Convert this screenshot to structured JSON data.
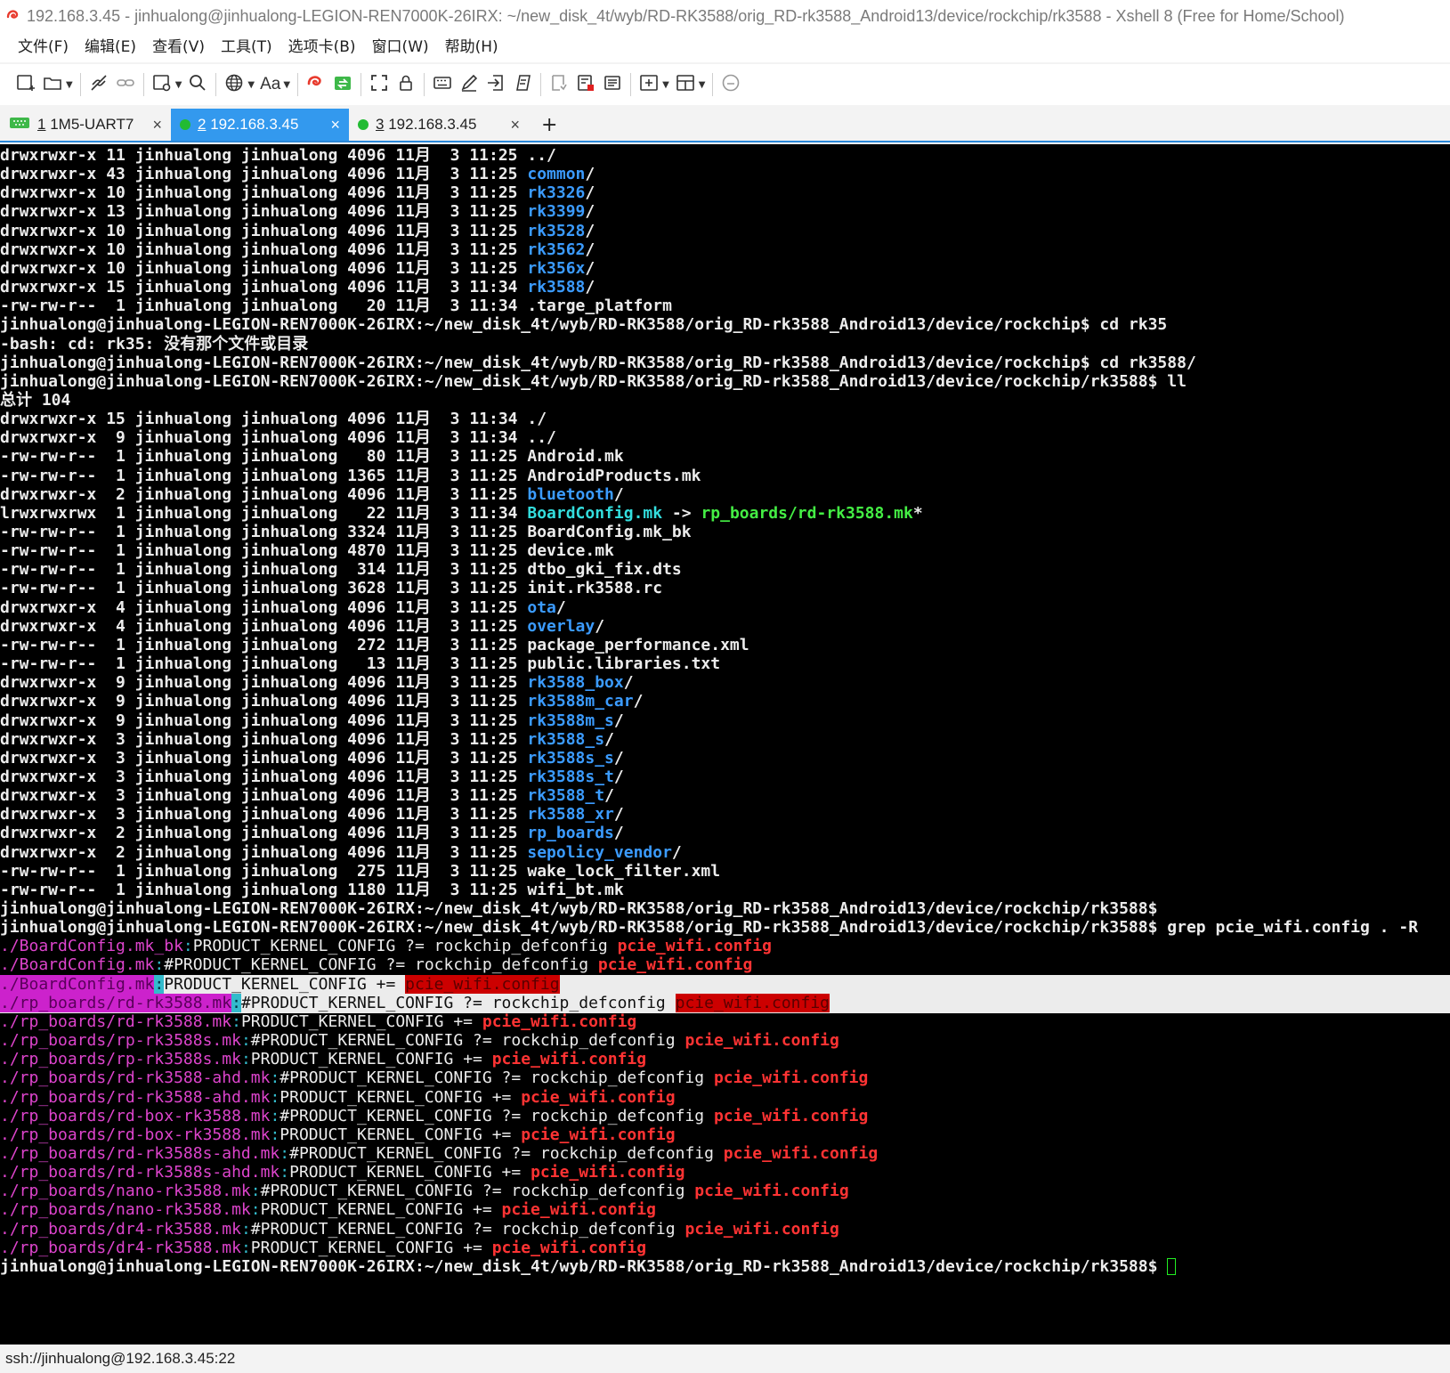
{
  "window": {
    "title": "192.168.3.45 - jinhualong@jinhualong-LEGION-REN7000K-26IRX: ~/new_disk_4t/wyb/RD-RK3588/orig_RD-rk3588_Android13/device/rockchip/rk3588 - Xshell 8 (Free for Home/School)"
  },
  "menu": [
    "文件(F)",
    "编辑(E)",
    "查看(V)",
    "工具(T)",
    "选项卡(B)",
    "窗口(W)",
    "帮助(H)"
  ],
  "toolbar": {
    "font_label": "Aa"
  },
  "tabs": [
    {
      "num": "1",
      "label": "1M5-UART7",
      "close": "×",
      "status": "serial"
    },
    {
      "num": "2",
      "label": "192.168.3.45",
      "close": "×",
      "status": "connected",
      "active": true
    },
    {
      "num": "3",
      "label": "192.168.3.45",
      "close": "×",
      "status": "connected"
    }
  ],
  "tab_add": "+",
  "colors": {
    "tab_active": "#3399ee",
    "connected": "#22bb33",
    "dir": "#3b9bff",
    "match": "#ff3333",
    "filename": "#dd44cc",
    "exe": "#44ee44"
  },
  "terminal": {
    "lines": [
      [
        {
          "t": "drwxrwxr-x 11 jinhualong jinhualong 4096 11月  3 11:25 ",
          "c": "b"
        },
        {
          "t": "../",
          "c": "b"
        }
      ],
      [
        {
          "t": "drwxrwxr-x 43 jinhualong jinhualong 4096 11月  3 11:25 ",
          "c": "b"
        },
        {
          "t": "common",
          "c": "dir"
        },
        {
          "t": "/",
          "c": "b"
        }
      ],
      [
        {
          "t": "drwxrwxr-x 10 jinhualong jinhualong 4096 11月  3 11:25 ",
          "c": "b"
        },
        {
          "t": "rk3326",
          "c": "dir"
        },
        {
          "t": "/",
          "c": "b"
        }
      ],
      [
        {
          "t": "drwxrwxr-x 13 jinhualong jinhualong 4096 11月  3 11:25 ",
          "c": "b"
        },
        {
          "t": "rk3399",
          "c": "dir"
        },
        {
          "t": "/",
          "c": "b"
        }
      ],
      [
        {
          "t": "drwxrwxr-x 10 jinhualong jinhualong 4096 11月  3 11:25 ",
          "c": "b"
        },
        {
          "t": "rk3528",
          "c": "dir"
        },
        {
          "t": "/",
          "c": "b"
        }
      ],
      [
        {
          "t": "drwxrwxr-x 10 jinhualong jinhualong 4096 11月  3 11:25 ",
          "c": "b"
        },
        {
          "t": "rk3562",
          "c": "dir"
        },
        {
          "t": "/",
          "c": "b"
        }
      ],
      [
        {
          "t": "drwxrwxr-x 10 jinhualong jinhualong 4096 11月  3 11:25 ",
          "c": "b"
        },
        {
          "t": "rk356x",
          "c": "dir"
        },
        {
          "t": "/",
          "c": "b"
        }
      ],
      [
        {
          "t": "drwxrwxr-x 15 jinhualong jinhualong 4096 11月  3 11:34 ",
          "c": "b"
        },
        {
          "t": "rk3588",
          "c": "dir"
        },
        {
          "t": "/",
          "c": "b"
        }
      ],
      [
        {
          "t": "-rw-rw-r--  1 jinhualong jinhualong   20 11月  3 11:34 .targe_platform",
          "c": "b"
        }
      ],
      [
        {
          "t": "jinhualong@jinhualong-LEGION-REN7000K-26IRX:~/new_disk_4t/wyb/RD-RK3588/orig_RD-rk3588_Android13/device/rockchip$ cd rk35",
          "c": "b"
        }
      ],
      [
        {
          "t": "-bash: cd: rk35: 没有那个文件或目录",
          "c": "b"
        }
      ],
      [
        {
          "t": "jinhualong@jinhualong-LEGION-REN7000K-26IRX:~/new_disk_4t/wyb/RD-RK3588/orig_RD-rk3588_Android13/device/rockchip$ cd rk3588/",
          "c": "b"
        }
      ],
      [
        {
          "t": "jinhualong@jinhualong-LEGION-REN7000K-26IRX:~/new_disk_4t/wyb/RD-RK3588/orig_RD-rk3588_Android13/device/rockchip/rk3588$ ll",
          "c": "b"
        }
      ],
      [
        {
          "t": "总计 104",
          "c": "b"
        }
      ],
      [
        {
          "t": "drwxrwxr-x 15 jinhualong jinhualong 4096 11月  3 11:34 ./",
          "c": "b"
        }
      ],
      [
        {
          "t": "drwxrwxr-x  9 jinhualong jinhualong 4096 11月  3 11:34 ../",
          "c": "b"
        }
      ],
      [
        {
          "t": "-rw-rw-r--  1 jinhualong jinhualong   80 11月  3 11:25 Android.mk",
          "c": "b"
        }
      ],
      [
        {
          "t": "-rw-rw-r--  1 jinhualong jinhualong 1365 11月  3 11:25 AndroidProducts.mk",
          "c": "b"
        }
      ],
      [
        {
          "t": "drwxrwxr-x  2 jinhualong jinhualong 4096 11月  3 11:25 ",
          "c": "b"
        },
        {
          "t": "bluetooth",
          "c": "dir"
        },
        {
          "t": "/",
          "c": "b"
        }
      ],
      [
        {
          "t": "lrwxrwxrwx  1 jinhualong jinhualong   22 11月  3 11:34 ",
          "c": "b"
        },
        {
          "t": "BoardConfig.mk",
          "c": "link"
        },
        {
          "t": " -> ",
          "c": "b"
        },
        {
          "t": "rp_boards/rd-rk3588.mk",
          "c": "exe"
        },
        {
          "t": "*",
          "c": "b"
        }
      ],
      [
        {
          "t": "-rw-rw-r--  1 jinhualong jinhualong 3324 11月  3 11:25 BoardConfig.mk_bk",
          "c": "b"
        }
      ],
      [
        {
          "t": "-rw-rw-r--  1 jinhualong jinhualong 4870 11月  3 11:25 device.mk",
          "c": "b"
        }
      ],
      [
        {
          "t": "-rw-rw-r--  1 jinhualong jinhualong  314 11月  3 11:25 dtbo_gki_fix.dts",
          "c": "b"
        }
      ],
      [
        {
          "t": "-rw-rw-r--  1 jinhualong jinhualong 3628 11月  3 11:25 init.rk3588.rc",
          "c": "b"
        }
      ],
      [
        {
          "t": "drwxrwxr-x  4 jinhualong jinhualong 4096 11月  3 11:25 ",
          "c": "b"
        },
        {
          "t": "ota",
          "c": "dir"
        },
        {
          "t": "/",
          "c": "b"
        }
      ],
      [
        {
          "t": "drwxrwxr-x  4 jinhualong jinhualong 4096 11月  3 11:25 ",
          "c": "b"
        },
        {
          "t": "overlay",
          "c": "dir"
        },
        {
          "t": "/",
          "c": "b"
        }
      ],
      [
        {
          "t": "-rw-rw-r--  1 jinhualong jinhualong  272 11月  3 11:25 package_performance.xml",
          "c": "b"
        }
      ],
      [
        {
          "t": "-rw-rw-r--  1 jinhualong jinhualong   13 11月  3 11:25 public.libraries.txt",
          "c": "b"
        }
      ],
      [
        {
          "t": "drwxrwxr-x  9 jinhualong jinhualong 4096 11月  3 11:25 ",
          "c": "b"
        },
        {
          "t": "rk3588_box",
          "c": "dir"
        },
        {
          "t": "/",
          "c": "b"
        }
      ],
      [
        {
          "t": "drwxrwxr-x  9 jinhualong jinhualong 4096 11月  3 11:25 ",
          "c": "b"
        },
        {
          "t": "rk3588m_car",
          "c": "dir"
        },
        {
          "t": "/",
          "c": "b"
        }
      ],
      [
        {
          "t": "drwxrwxr-x  9 jinhualong jinhualong 4096 11月  3 11:25 ",
          "c": "b"
        },
        {
          "t": "rk3588m_s",
          "c": "dir"
        },
        {
          "t": "/",
          "c": "b"
        }
      ],
      [
        {
          "t": "drwxrwxr-x  3 jinhualong jinhualong 4096 11月  3 11:25 ",
          "c": "b"
        },
        {
          "t": "rk3588_s",
          "c": "dir"
        },
        {
          "t": "/",
          "c": "b"
        }
      ],
      [
        {
          "t": "drwxrwxr-x  3 jinhualong jinhualong 4096 11月  3 11:25 ",
          "c": "b"
        },
        {
          "t": "rk3588s_s",
          "c": "dir"
        },
        {
          "t": "/",
          "c": "b"
        }
      ],
      [
        {
          "t": "drwxrwxr-x  3 jinhualong jinhualong 4096 11月  3 11:25 ",
          "c": "b"
        },
        {
          "t": "rk3588s_t",
          "c": "dir"
        },
        {
          "t": "/",
          "c": "b"
        }
      ],
      [
        {
          "t": "drwxrwxr-x  3 jinhualong jinhualong 4096 11月  3 11:25 ",
          "c": "b"
        },
        {
          "t": "rk3588_t",
          "c": "dir"
        },
        {
          "t": "/",
          "c": "b"
        }
      ],
      [
        {
          "t": "drwxrwxr-x  3 jinhualong jinhualong 4096 11月  3 11:25 ",
          "c": "b"
        },
        {
          "t": "rk3588_xr",
          "c": "dir"
        },
        {
          "t": "/",
          "c": "b"
        }
      ],
      [
        {
          "t": "drwxrwxr-x  2 jinhualong jinhualong 4096 11月  3 11:25 ",
          "c": "b"
        },
        {
          "t": "rp_boards",
          "c": "dir"
        },
        {
          "t": "/",
          "c": "b"
        }
      ],
      [
        {
          "t": "drwxrwxr-x  2 jinhualong jinhualong 4096 11月  3 11:25 ",
          "c": "b"
        },
        {
          "t": "sepolicy_vendor",
          "c": "dir"
        },
        {
          "t": "/",
          "c": "b"
        }
      ],
      [
        {
          "t": "-rw-rw-r--  1 jinhualong jinhualong  275 11月  3 11:25 wake_lock_filter.xml",
          "c": "b"
        }
      ],
      [
        {
          "t": "-rw-rw-r--  1 jinhualong jinhualong 1180 11月  3 11:25 wifi_bt.mk",
          "c": "b"
        }
      ],
      [
        {
          "t": "jinhualong@jinhualong-LEGION-REN7000K-26IRX:~/new_disk_4t/wyb/RD-RK3588/orig_RD-rk3588_Android13/device/rockchip/rk3588$",
          "c": "b"
        }
      ],
      [
        {
          "t": "jinhualong@jinhualong-LEGION-REN7000K-26IRX:~/new_disk_4t/wyb/RD-RK3588/orig_RD-rk3588_Android13/device/rockchip/rk3588$ grep pcie_wifi.config . -R",
          "c": "b"
        }
      ],
      [
        {
          "t": "./BoardConfig.mk_bk",
          "c": "fn"
        },
        {
          "t": ":",
          "c": "sep"
        },
        {
          "t": "PRODUCT_KERNEL_CONFIG ?= rockchip_defconfig ",
          "c": "plain"
        },
        {
          "t": "pcie_wifi.config",
          "c": "match"
        }
      ],
      [
        {
          "t": "./BoardConfig.mk",
          "c": "fn"
        },
        {
          "t": ":",
          "c": "sep"
        },
        {
          "t": "#PRODUCT_KERNEL_CONFIG ?= rockchip_defconfig ",
          "c": "plain"
        },
        {
          "t": "pcie_wifi.config",
          "c": "match"
        }
      ],
      [
        {
          "t": "./BoardConfig.mk",
          "c": "fn"
        },
        {
          "t": ":",
          "c": "sep"
        },
        {
          "t": "PRODUCT_KERNEL_CONFIG += ",
          "c": "plain"
        },
        {
          "t": "pcie_wifi.config",
          "c": "match"
        }
      ],
      [
        {
          "t": "./rp_boards/rd-rk3588.mk",
          "c": "fn"
        },
        {
          "t": ":",
          "c": "sep"
        },
        {
          "t": "#PRODUCT_KERNEL_CONFIG ?= rockchip_defconfig ",
          "c": "plain"
        },
        {
          "t": "pcie_wifi.config",
          "c": "match"
        }
      ],
      [
        {
          "t": "./rp_boards/rd-rk3588.mk",
          "c": "fn"
        },
        {
          "t": ":",
          "c": "sep"
        },
        {
          "t": "PRODUCT_KERNEL_CONFIG += ",
          "c": "plain"
        },
        {
          "t": "pcie_wifi.config",
          "c": "match"
        }
      ],
      [
        {
          "t": "./rp_boards/rp-rk3588s.mk",
          "c": "fn"
        },
        {
          "t": ":",
          "c": "sep"
        },
        {
          "t": "#PRODUCT_KERNEL_CONFIG ?= rockchip_defconfig ",
          "c": "plain"
        },
        {
          "t": "pcie_wifi.config",
          "c": "match"
        }
      ],
      [
        {
          "t": "./rp_boards/rp-rk3588s.mk",
          "c": "fn"
        },
        {
          "t": ":",
          "c": "sep"
        },
        {
          "t": "PRODUCT_KERNEL_CONFIG += ",
          "c": "plain"
        },
        {
          "t": "pcie_wifi.config",
          "c": "match"
        }
      ],
      [
        {
          "t": "./rp_boards/rd-rk3588-ahd.mk",
          "c": "fn"
        },
        {
          "t": ":",
          "c": "sep"
        },
        {
          "t": "#PRODUCT_KERNEL_CONFIG ?= rockchip_defconfig ",
          "c": "plain"
        },
        {
          "t": "pcie_wifi.config",
          "c": "match"
        }
      ],
      [
        {
          "t": "./rp_boards/rd-rk3588-ahd.mk",
          "c": "fn"
        },
        {
          "t": ":",
          "c": "sep"
        },
        {
          "t": "PRODUCT_KERNEL_CONFIG += ",
          "c": "plain"
        },
        {
          "t": "pcie_wifi.config",
          "c": "match"
        }
      ],
      [
        {
          "t": "./rp_boards/rd-box-rk3588.mk",
          "c": "fn"
        },
        {
          "t": ":",
          "c": "sep"
        },
        {
          "t": "#PRODUCT_KERNEL_CONFIG ?= rockchip_defconfig ",
          "c": "plain"
        },
        {
          "t": "pcie_wifi.config",
          "c": "match"
        }
      ],
      [
        {
          "t": "./rp_boards/rd-box-rk3588.mk",
          "c": "fn"
        },
        {
          "t": ":",
          "c": "sep"
        },
        {
          "t": "PRODUCT_KERNEL_CONFIG += ",
          "c": "plain"
        },
        {
          "t": "pcie_wifi.config",
          "c": "match"
        }
      ],
      [
        {
          "t": "./rp_boards/rd-rk3588s-ahd.mk",
          "c": "fn"
        },
        {
          "t": ":",
          "c": "sep"
        },
        {
          "t": "#PRODUCT_KERNEL_CONFIG ?= rockchip_defconfig ",
          "c": "plain"
        },
        {
          "t": "pcie_wifi.config",
          "c": "match"
        }
      ],
      [
        {
          "t": "./rp_boards/rd-rk3588s-ahd.mk",
          "c": "fn"
        },
        {
          "t": ":",
          "c": "sep"
        },
        {
          "t": "PRODUCT_KERNEL_CONFIG += ",
          "c": "plain"
        },
        {
          "t": "pcie_wifi.config",
          "c": "match"
        }
      ],
      [
        {
          "t": "./rp_boards/nano-rk3588.mk",
          "c": "fn"
        },
        {
          "t": ":",
          "c": "sep"
        },
        {
          "t": "#PRODUCT_KERNEL_CONFIG ?= rockchip_defconfig ",
          "c": "plain"
        },
        {
          "t": "pcie_wifi.config",
          "c": "match"
        }
      ],
      [
        {
          "t": "./rp_boards/nano-rk3588.mk",
          "c": "fn"
        },
        {
          "t": ":",
          "c": "sep"
        },
        {
          "t": "PRODUCT_KERNEL_CONFIG += ",
          "c": "plain"
        },
        {
          "t": "pcie_wifi.config",
          "c": "match"
        }
      ],
      [
        {
          "t": "./rp_boards/dr4-rk3588.mk",
          "c": "fn"
        },
        {
          "t": ":",
          "c": "sep"
        },
        {
          "t": "#PRODUCT_KERNEL_CONFIG ?= rockchip_defconfig ",
          "c": "plain"
        },
        {
          "t": "pcie_wifi.config",
          "c": "match"
        }
      ],
      [
        {
          "t": "./rp_boards/dr4-rk3588.mk",
          "c": "fn"
        },
        {
          "t": ":",
          "c": "sep"
        },
        {
          "t": "PRODUCT_KERNEL_CONFIG += ",
          "c": "plain"
        },
        {
          "t": "pcie_wifi.config",
          "c": "match"
        }
      ],
      [
        {
          "t": "jinhualong@jinhualong-LEGION-REN7000K-26IRX:~/new_disk_4t/wyb/RD-RK3588/orig_RD-rk3588_Android13/device/rockchip/rk3588$ ",
          "c": "b"
        },
        {
          "t": "",
          "c": "cursor"
        }
      ]
    ],
    "selected_lines": [
      44,
      45
    ]
  },
  "status": {
    "connection": "ssh://jinhualong@192.168.3.45:22"
  }
}
